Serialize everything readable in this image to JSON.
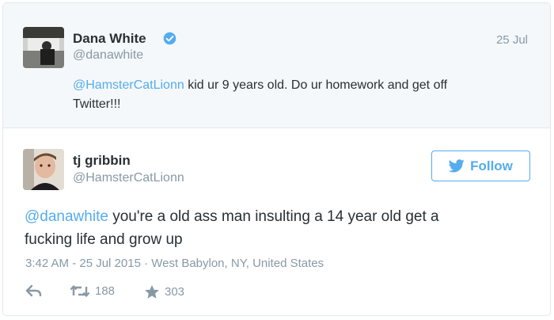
{
  "parent_tweet": {
    "author_name": "Dana White",
    "author_handle": "@danawhite",
    "date": "25 Jul",
    "mention": "@HamsterCatLionn",
    "text_line1": " kid ur 9 years old. Do ur homework and get off",
    "text_line2": "Twitter!!!"
  },
  "main_tweet": {
    "author_name": "tj gribbin",
    "author_handle": "@HamsterCatLionn",
    "follow_label": "Follow",
    "mention": "@danawhite",
    "text_line1": " you're a old ass man insulting a 14 year old get a",
    "text_line2": "fucking life and grow up",
    "meta": "3:42 AM - 25 Jul 2015 · West Babylon, NY, United States",
    "retweets": "188",
    "favorites": "303"
  },
  "icons": {
    "verified": "verified-badge-icon",
    "follow": "twitter-bird-icon",
    "reply": "reply-icon",
    "retweet": "retweet-icon",
    "favorite": "star-icon"
  },
  "colors": {
    "accent": "#55acee",
    "muted": "#8899a6",
    "text": "#292f33",
    "parent_background": "#f5f8fa",
    "border": "#e1e8ed"
  }
}
